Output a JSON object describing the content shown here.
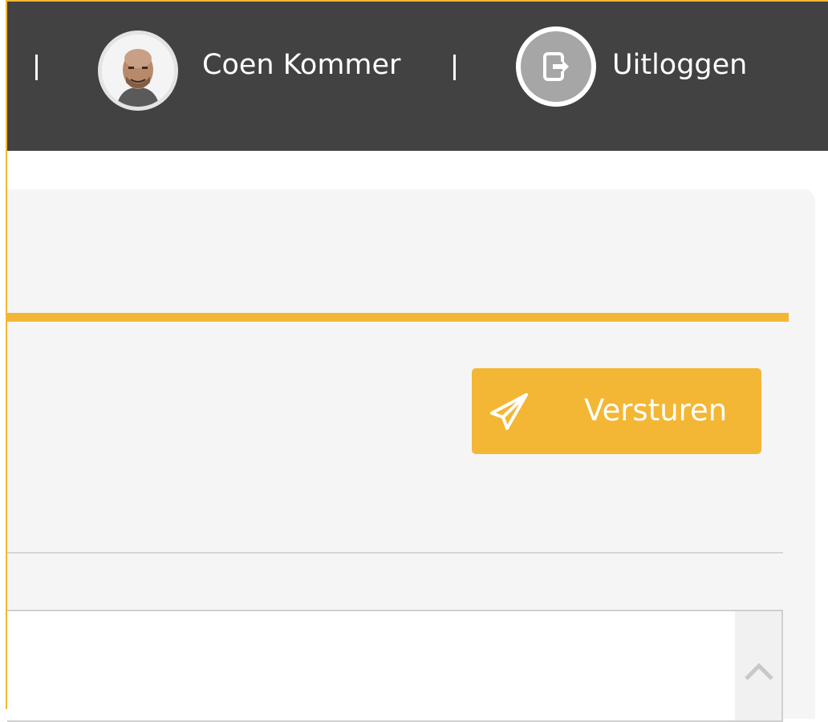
{
  "header": {
    "separator": "|",
    "user": {
      "name": "Coen Kommer",
      "avatar_icon": "user-avatar"
    },
    "logout": {
      "label": "Uitloggen",
      "icon": "logout-icon"
    }
  },
  "compose": {
    "send_label": "Versturen",
    "send_icon": "paper-plane-icon"
  },
  "colors": {
    "accent": "#f3b735",
    "topbar": "#424242",
    "panel": "#f5f5f5"
  }
}
